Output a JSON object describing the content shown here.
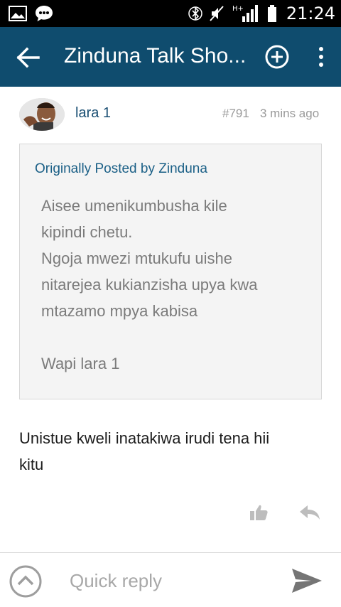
{
  "status_bar": {
    "time": "21:24",
    "network_label": "H+"
  },
  "app_bar": {
    "title": "Zinduna Talk Sho..."
  },
  "post": {
    "author": "lara 1",
    "post_number": "#791",
    "time_ago": "3 mins ago",
    "quote": {
      "header": "Originally Posted by Zinduna",
      "lines": [
        "Aisee umenikumbusha kile",
        "kipindi chetu.",
        "Ngoja mwezi mtukufu uishe",
        "nitarejea kukianzisha upya kwa",
        "mtazamo mpya kabisa",
        "",
        "Wapi lara 1"
      ]
    },
    "body_lines": [
      "Unistue kweli inatakiwa irudi tena hii",
      "kitu"
    ]
  },
  "quick_reply": {
    "placeholder": "Quick reply"
  },
  "colors": {
    "app_bar": "#0f4c6e",
    "link": "#1a5f86",
    "status_bar": "#000000"
  }
}
